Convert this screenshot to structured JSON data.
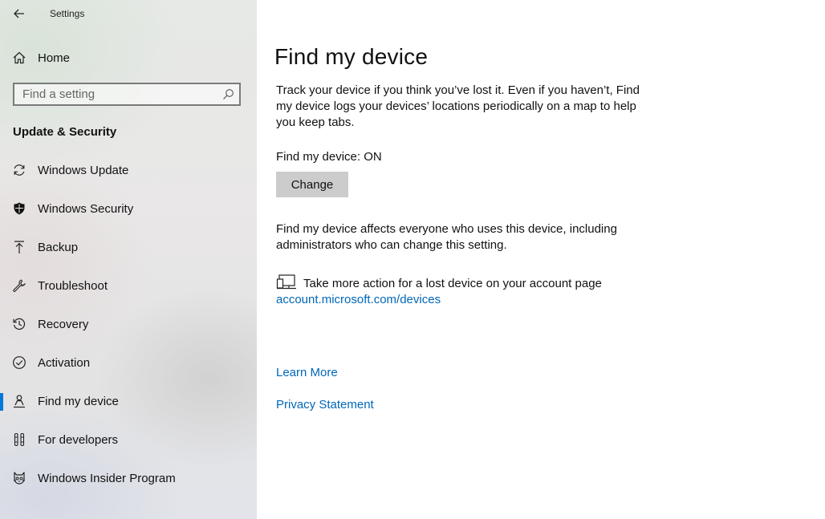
{
  "window": {
    "title": "Settings"
  },
  "sidebar": {
    "home_label": "Home",
    "search": {
      "placeholder": "Find a setting"
    },
    "section_heading": "Update & Security",
    "items": [
      {
        "label": "Windows Update",
        "icon": "sync-icon"
      },
      {
        "label": "Windows Security",
        "icon": "shield-icon"
      },
      {
        "label": "Backup",
        "icon": "backup-arrow-icon"
      },
      {
        "label": "Troubleshoot",
        "icon": "wrench-icon"
      },
      {
        "label": "Recovery",
        "icon": "history-icon"
      },
      {
        "label": "Activation",
        "icon": "check-circle-icon"
      },
      {
        "label": "Find my device",
        "icon": "person-location-icon",
        "selected": true
      },
      {
        "label": "For developers",
        "icon": "developer-tools-icon"
      },
      {
        "label": "Windows Insider Program",
        "icon": "insider-cat-icon"
      }
    ]
  },
  "main": {
    "title": "Find my device",
    "description": "Track your device if you think you’ve lost it. Even if you haven’t, Find my device logs your devices’ locations periodically on a map to help you keep tabs.",
    "status": "Find my device: ON",
    "change_button": "Change",
    "affects_note": "Find my device affects everyone who uses this device, including administrators who can change this setting.",
    "action_text": "Take more action for a lost device on your account page",
    "account_link": "account.microsoft.com/devices",
    "learn_more": "Learn More",
    "privacy": "Privacy Statement"
  },
  "colors": {
    "accent": "#0078d7",
    "link": "#0067b8",
    "button_bg": "#cccccc"
  }
}
